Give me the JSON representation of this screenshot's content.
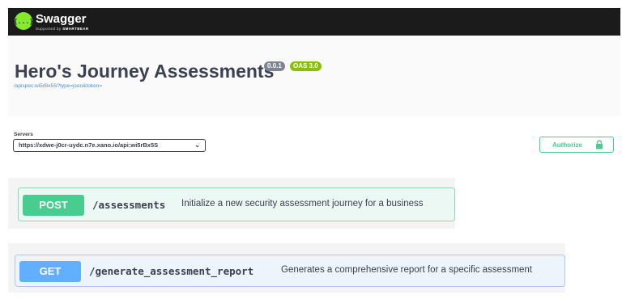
{
  "topbar": {
    "brand": "Swagger",
    "brand_sub_prefix": "Supported by ",
    "brand_sub_company": "SMARTBEAR",
    "logo_glyph": "{...}",
    "logo_color": "#85ea2d"
  },
  "info": {
    "title": "Hero's Journey Assessments",
    "version": "0.0.1",
    "oas": "OAS 3.0",
    "spec_link": "/apispec:wi5rBx5S?type=json&token="
  },
  "servers": {
    "label": "Servers",
    "selected": "https://xdwe-j0cr-uydc.n7e.xano.io/api:wi5rBx5S"
  },
  "authorize": {
    "label": "Authorize",
    "icon": "lock-icon",
    "color": "#49cc90"
  },
  "operations": [
    {
      "method": "POST",
      "path": "/assessments",
      "summary": "Initialize a new security assessment journey for a business",
      "color": "#49cc90"
    },
    {
      "method": "GET",
      "path": "/generate_assessment_report",
      "summary": "Generates a comprehensive report for a specific assessment",
      "color": "#61affe"
    }
  ]
}
